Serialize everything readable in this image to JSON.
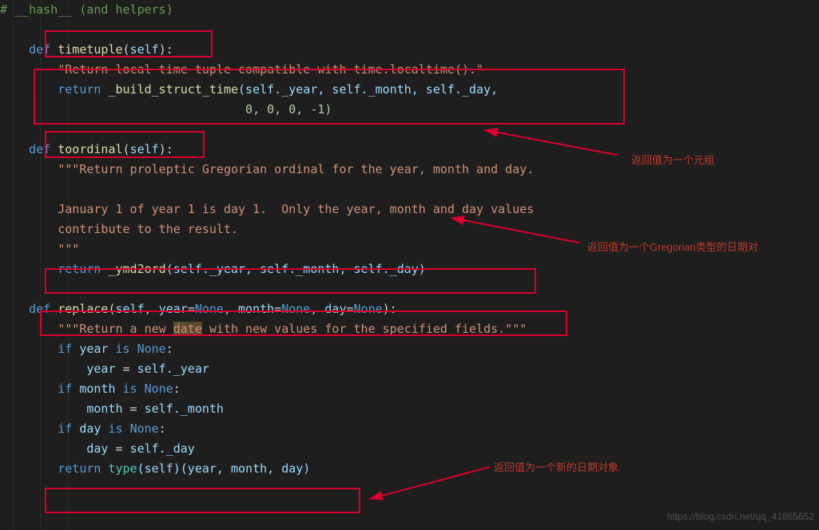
{
  "watermark": "https://blog.csdn.net/qq_41865652",
  "annot1": "返回值为一个元组",
  "annot2": "返回值为一个Gregorian类型的日期对",
  "annot3": "返回值为一个新的日期对象",
  "code": {
    "c0_comment": "# __hash__ (and helpers)",
    "c1_def": "    def ",
    "c1_name": "timetuple",
    "c1_open": "(",
    "c1_self": "self",
    "c1_close": "):",
    "c2_indent": "        ",
    "c2_str": "\"Return local time tuple compatible with time.localtime().\"",
    "c3_indent": "        ",
    "c3_ret": "return ",
    "c3_fn": "_build_struct_time",
    "c3_args": "(self._year, self._month, self._day,",
    "c4_indent": "                                  ",
    "c4_args": "0, 0, 0, -1)",
    "c5_def": "    def ",
    "c5_name": "toordinal",
    "c5_open": "(",
    "c5_self": "self",
    "c5_close": "):",
    "c6_indent": "        ",
    "c6_str": "\"\"\"Return proleptic Gregorian ordinal for the year, month and day.",
    "c7_indent": "        ",
    "c7_str": "January 1 of year 1 is day 1.  Only the year, month and day values",
    "c8_indent": "        ",
    "c8_str": "contribute to the result.",
    "c9_indent": "        ",
    "c9_str": "\"\"\"",
    "c10_indent": "        ",
    "c10_ret": "return ",
    "c10_fn": "_ymd2ord",
    "c10_args": "(self._year, self._month, self._day)",
    "c11_def": "    def ",
    "c11_name": "replace",
    "c11_open": "(",
    "c11_self": "self",
    "c11_c1": ", ",
    "c11_p1": "year",
    "c11_eq1": "=",
    "c11_n1": "None",
    "c11_c2": ", ",
    "c11_p2": "month",
    "c11_eq2": "=",
    "c11_n2": "None",
    "c11_c3": ", ",
    "c11_p3": "day",
    "c11_eq3": "=",
    "c11_n3": "None",
    "c11_close": "):",
    "c12_indent": "        ",
    "c12_str1": "\"\"\"Return a new ",
    "c12_hl": "date",
    "c12_str2": " with new values for the specified fields.\"\"\"",
    "c13_indent": "        ",
    "c13_if": "if ",
    "c13_v": "year ",
    "c13_is": "is ",
    "c13_none": "None",
    "c13_colon": ":",
    "c14_indent": "            ",
    "c14_v": "year",
    "c14_eq": " = ",
    "c14_rhs": "self._year",
    "c15_indent": "        ",
    "c15_if": "if ",
    "c15_v": "month ",
    "c15_is": "is ",
    "c15_none": "None",
    "c15_colon": ":",
    "c16_indent": "            ",
    "c16_v": "month",
    "c16_eq": " = ",
    "c16_rhs": "self._month",
    "c17_indent": "        ",
    "c17_if": "if ",
    "c17_v": "day ",
    "c17_is": "is ",
    "c17_none": "None",
    "c17_colon": ":",
    "c18_indent": "            ",
    "c18_v": "day",
    "c18_eq": " = ",
    "c18_rhs": "self._day",
    "c19_indent": "        ",
    "c19_ret": "return ",
    "c19_type": "type",
    "c19_args": "(self)(year, month, day)"
  }
}
